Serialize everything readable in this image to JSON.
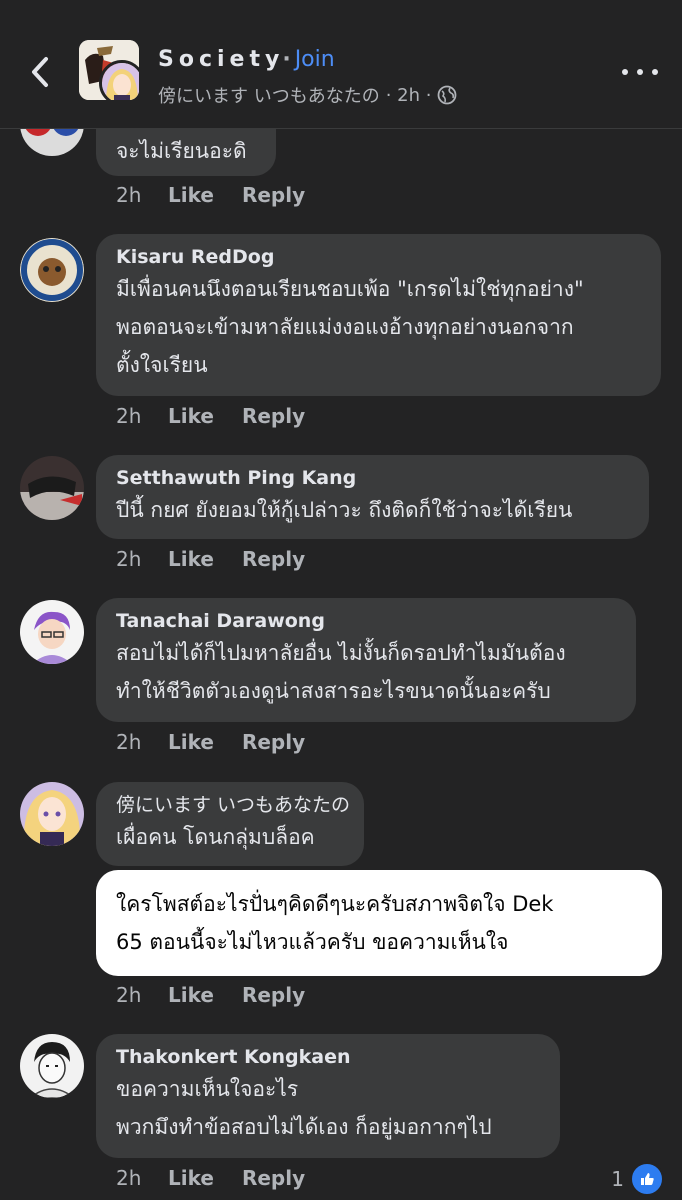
{
  "header": {
    "group_name": "Society",
    "separator": "·",
    "join_label": "Join",
    "author": "傍にいます いつもあなたの",
    "time": "· 2h ·",
    "back_icon": "chevron-left-icon",
    "privacy_icon": "globe-icon",
    "more_icon": "more-horizontal-icon"
  },
  "comments": [
    {
      "author": "",
      "text": "จะไม่เรียนอะดิ",
      "time": "2h",
      "like": "Like",
      "reply": "Reply"
    },
    {
      "author": "Kisaru RedDog",
      "text": "มีเพื่อนคนนึงตอนเรียนชอบเพ้อ \"เกรดไม่ใช่ทุกอย่าง\"\nพอตอนจะเข้ามหาลัยแม่งงอแงอ้างทุกอย่างนอกจาก\nตั้งใจเรียน",
      "time": "2h",
      "like": "Like",
      "reply": "Reply"
    },
    {
      "author": "Setthawuth Ping Kang",
      "text": "ปีนี้ กยศ ยังยอมให้กู้เปล่าวะ ถึงติดก็ใช้ว่าจะได้เรียน",
      "time": "2h",
      "like": "Like",
      "reply": "Reply"
    },
    {
      "author": "Tanachai Darawong",
      "text": "สอบไม่ได้ก็ไปมหาลัยอื่น ไม่งั้นก็ดรอปทำไมมันต้อง\nทำให้ชีวิตตัวเองดูน่าสงสารอะไรขนาดนั้นอะครับ",
      "time": "2h",
      "like": "Like",
      "reply": "Reply"
    },
    {
      "author": "傍にいます いつもあなたの",
      "text": "เผื่อคน โดนกลุ่มบล็อค",
      "text2": "ใครโพสต์อะไรปั่นๆคิดดีๆนะครับสภาพจิตใจ Dek\n65 ตอนนี้จะไม่ไหวแล้วครับ ขอความเห็นใจ",
      "time": "2h",
      "like": "Like",
      "reply": "Reply"
    },
    {
      "author": "Thakonkert Kongkaen",
      "text": "ขอความเห็นใจอะไร\nพวกมึงทำข้อสอบไม่ได้เอง ก็อยู่มอกากๆไป",
      "time": "2h",
      "like": "Like",
      "reply": "Reply",
      "reaction_count": "1",
      "reaction_icon": "thumbs-up-icon"
    }
  ],
  "colors": {
    "background": "#232324",
    "bubble": "#3a3b3c",
    "highlight_bubble": "#ffffff",
    "link": "#4d8df6",
    "like_badge": "#2d7cf0"
  }
}
